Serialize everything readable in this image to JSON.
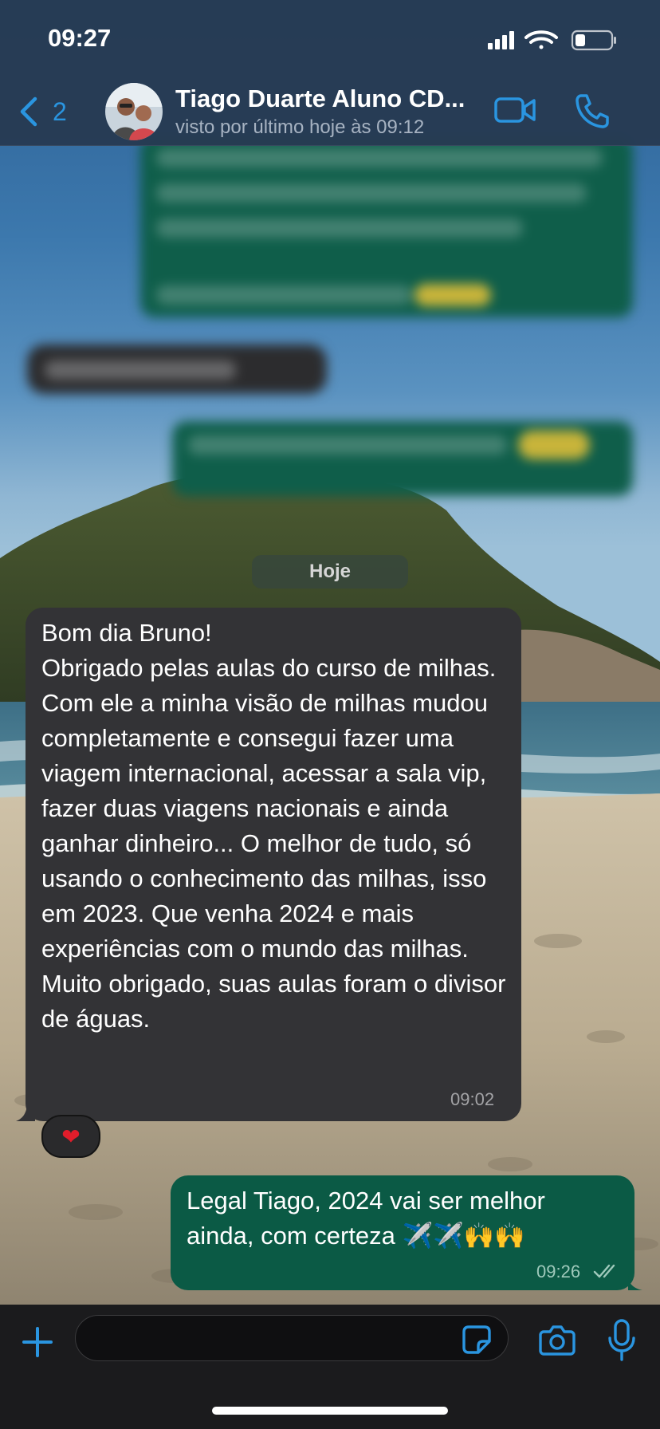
{
  "status_bar": {
    "time": "09:27"
  },
  "header": {
    "back_count": "2",
    "contact_name": "Tiago Duarte Aluno CD...",
    "contact_status": "visto por último hoje às 09:12"
  },
  "date_separator": "Hoje",
  "messages": {
    "incoming": {
      "text": "Bom dia Bruno!\nObrigado pelas aulas do curso de milhas.\nCom ele a minha visão de milhas mudou completamente e consegui fazer uma viagem internacional, acessar a sala vip, fazer duas viagens nacionais e ainda ganhar dinheiro... O melhor de tudo, só usando o conhecimento das milhas, isso em 2023. Que venha 2024 e mais experiências com o mundo das milhas. Muito obrigado, suas aulas foram o divisor de águas.",
      "time": "09:02",
      "reaction": "❤"
    },
    "outgoing": {
      "text": "Legal Tiago, 2024 vai ser melhor ainda, com certeza ✈️✈️🙌🙌",
      "time": "09:26"
    }
  },
  "input": {
    "value": "",
    "placeholder": ""
  },
  "colors": {
    "accent": "#2a95e0",
    "incoming_bubble": "#333336",
    "outgoing_bubble": "#0b5a45",
    "header_bg": "#263a52"
  },
  "icons": {
    "back": "chevron-left-icon",
    "video": "video-camera-icon",
    "call": "phone-icon",
    "plus": "plus-icon",
    "sticker": "sticker-icon",
    "camera": "camera-icon",
    "mic": "microphone-icon",
    "read": "double-check-icon"
  }
}
